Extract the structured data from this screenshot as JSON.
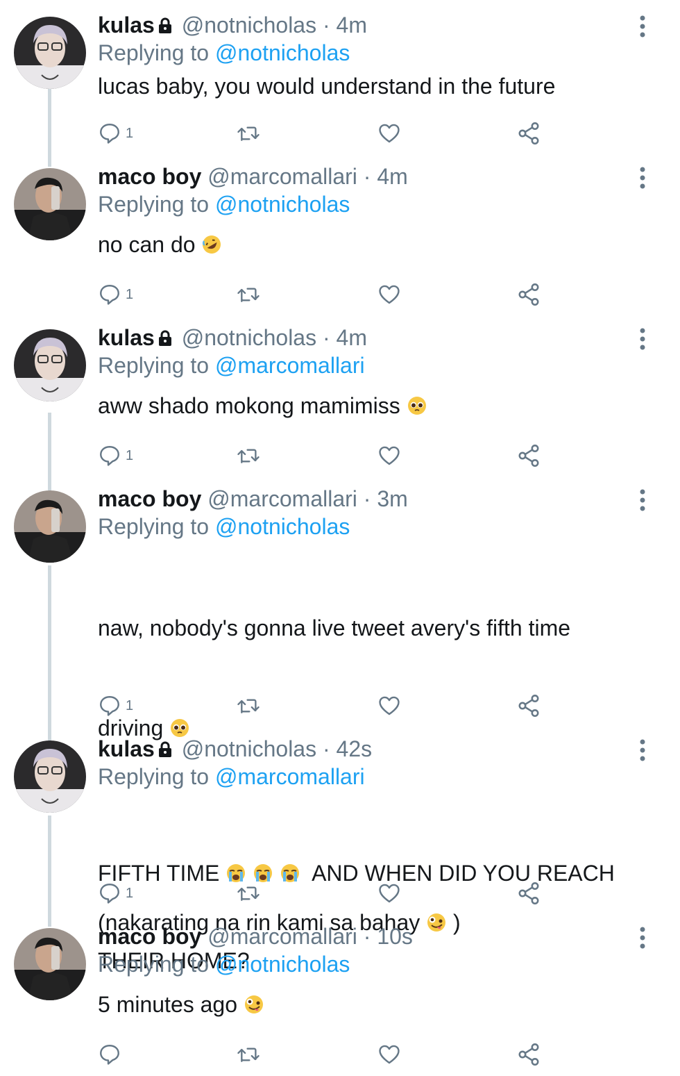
{
  "tweets": [
    {
      "name": "kulas",
      "locked": true,
      "handle": "@notnicholas",
      "dot": "·",
      "time": "4m",
      "replying_label": "Replying to",
      "replying_to": "@notnicholas",
      "lines": [
        "lucas baby, you would understand in the future"
      ],
      "reply_count": "1",
      "avatar": "kulas"
    },
    {
      "name": "maco boy",
      "locked": false,
      "handle": "@marcomallari",
      "dot": "·",
      "time": "4m",
      "replying_label": "Replying to",
      "replying_to": "@notnicholas",
      "lines": [
        "no can do"
      ],
      "emoji_after": "rofl-emoji",
      "reply_count": "1",
      "avatar": "maco"
    },
    {
      "name": "kulas",
      "locked": true,
      "handle": "@notnicholas",
      "dot": "·",
      "time": "4m",
      "replying_label": "Replying to",
      "replying_to": "@marcomallari",
      "lines": [
        "aww shado mokong mamimiss"
      ],
      "emoji_after": "pleading-face-emoji",
      "reply_count": "1",
      "avatar": "kulas"
    },
    {
      "name": "maco boy",
      "locked": false,
      "handle": "@marcomallari",
      "dot": "·",
      "time": "3m",
      "replying_label": "Replying to",
      "replying_to": "@notnicholas",
      "lines": [
        "naw, nobody's gonna live tweet avery's fifth time",
        "driving",
        "",
        "(nakarating na rin kami sa bahay",
        ")"
      ],
      "reply_count": "1",
      "avatar": "maco"
    },
    {
      "name": "kulas",
      "locked": true,
      "handle": "@notnicholas",
      "dot": "·",
      "time": "42s",
      "replying_label": "Replying to",
      "replying_to": "@marcomallari",
      "lines": [
        "FIFTH TIME",
        "AND WHEN DID YOU REACH",
        "THEIR HOME?"
      ],
      "reply_count": "1",
      "avatar": "kulas"
    },
    {
      "name": "maco boy",
      "locked": false,
      "handle": "@marcomallari",
      "dot": "·",
      "time": "10s",
      "replying_label": "Replying to",
      "replying_to": "@notnicholas",
      "lines": [
        "5 minutes ago"
      ],
      "emoji_after": "zany-face-emoji",
      "reply_count": "",
      "avatar": "maco"
    }
  ],
  "colors": {
    "mention": "#1da1f2",
    "secondary_text": "#657786",
    "thread_line": "#cfd9de"
  }
}
